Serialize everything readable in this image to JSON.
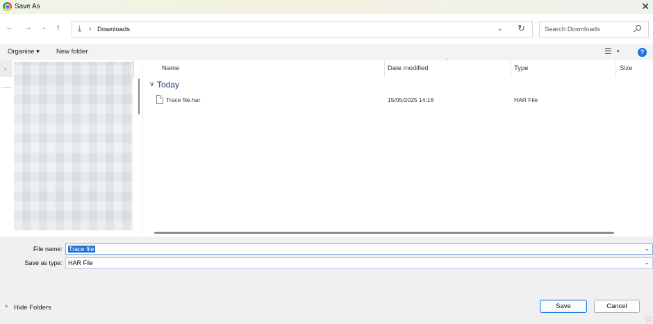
{
  "window": {
    "title": "Save As",
    "close_glyph": "✕",
    "app_icon": "chrome-icon"
  },
  "nav": {
    "back_glyph": "←",
    "forward_glyph": "→",
    "recent_glyph": "⌄",
    "up_glyph": "↑"
  },
  "address": {
    "folder_icon": "download-arrow-icon",
    "separator": "›",
    "location": "Downloads",
    "dropdown_glyph": "⌄",
    "refresh_glyph": "↻"
  },
  "search": {
    "placeholder": "Search Downloads"
  },
  "toolbar": {
    "organise_label": "Organise ▾",
    "new_folder_label": "New folder",
    "view_glyph": "☰",
    "view_caret": "▾",
    "help_glyph": "?"
  },
  "navpane": {
    "expand_glyph": "›"
  },
  "filelist": {
    "columns": [
      "Name",
      "Date modified",
      "Type",
      "Size"
    ],
    "groups": [
      {
        "label": "Today",
        "chevron": "∨",
        "files": [
          {
            "name": "Trace file.har",
            "date_modified": "15/05/2025 14:16",
            "type": "HAR File",
            "size": ""
          }
        ]
      }
    ]
  },
  "form": {
    "file_name_label": "File name:",
    "file_name_value": "Trace file",
    "save_type_label": "Save as type:",
    "save_type_value": "HAR File",
    "dropdown_glyph": "⌄"
  },
  "footer": {
    "hide_folders_chevron": "^",
    "hide_folders_label": "Hide Folders",
    "save_label": "Save",
    "cancel_label": "Cancel"
  },
  "colors": {
    "accent": "#1a73e8",
    "selection": "#1f6fd1",
    "group_label": "#1f3f73"
  }
}
